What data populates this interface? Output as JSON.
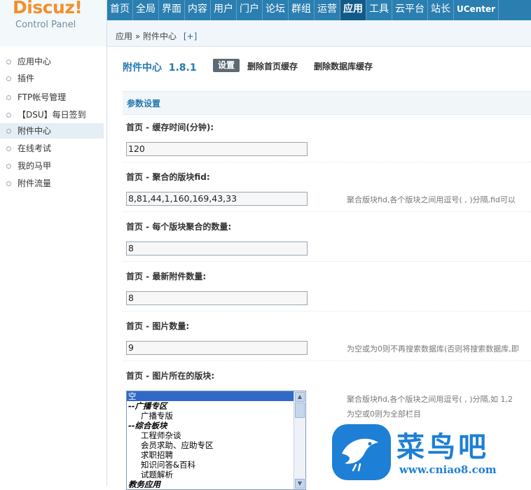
{
  "logo": {
    "brand": "Discuz!",
    "sub": "Control Panel"
  },
  "topnav": [
    "首页",
    "全局",
    "界面",
    "内容",
    "用户",
    "门户",
    "论坛",
    "群组",
    "运营",
    "应用",
    "工具",
    "云平台",
    "站长",
    "UCenter"
  ],
  "breadcrumb": {
    "home": "应用",
    "sep": "»",
    "current": "附件中心",
    "add": "[+]"
  },
  "sidebar": [
    "应用中心",
    "插件",
    "FTP帐号管理",
    "【DSU】每日签到",
    "附件中心",
    "在线考试",
    "我的马甲",
    "附件流量"
  ],
  "plugin": {
    "title": "附件中心  1.8.1",
    "tab_settings": "设置",
    "tab_clear_home": "删除首页缓存",
    "tab_clear_db": "删除数据库缓存"
  },
  "section": "参数设置",
  "rows": [
    {
      "label": "首页  - 缓存时间(分钟):",
      "value": "120",
      "tip": ""
    },
    {
      "label": "首页  - 聚合的版块fid:",
      "value": "8,81,44,1,160,169,43,33",
      "tip": "聚合版块fid,各个版块之间用逗号( , )分隔,fid可以"
    },
    {
      "label": "首页  - 每个版块聚合的数量:",
      "value": "8",
      "tip": ""
    },
    {
      "label": "首页  - 最新附件数量:",
      "value": "8",
      "tip": ""
    },
    {
      "label": "首页  - 图片数量:",
      "value": "9",
      "tip": "为空或为0则不再搜索数据库(否则将搜索数据库,即"
    }
  ],
  "forum_row": {
    "label": "首页  - 图片所在的版块:",
    "tip1": "聚合版块fid,各个版块之间用逗号( , )分隔,如  1,2",
    "tip2": "为空或0则为全部栏目"
  },
  "listbox": [
    "空",
    "--广播专区",
    "广播专版",
    "--综合板块",
    "工程师杂谈",
    "会员求助、应助专区",
    "求职招聘",
    "知识问答&百科",
    "试题解析",
    "教务应用"
  ],
  "watermark": {
    "name": "菜鸟吧",
    "url": "www.cniao8.com"
  }
}
